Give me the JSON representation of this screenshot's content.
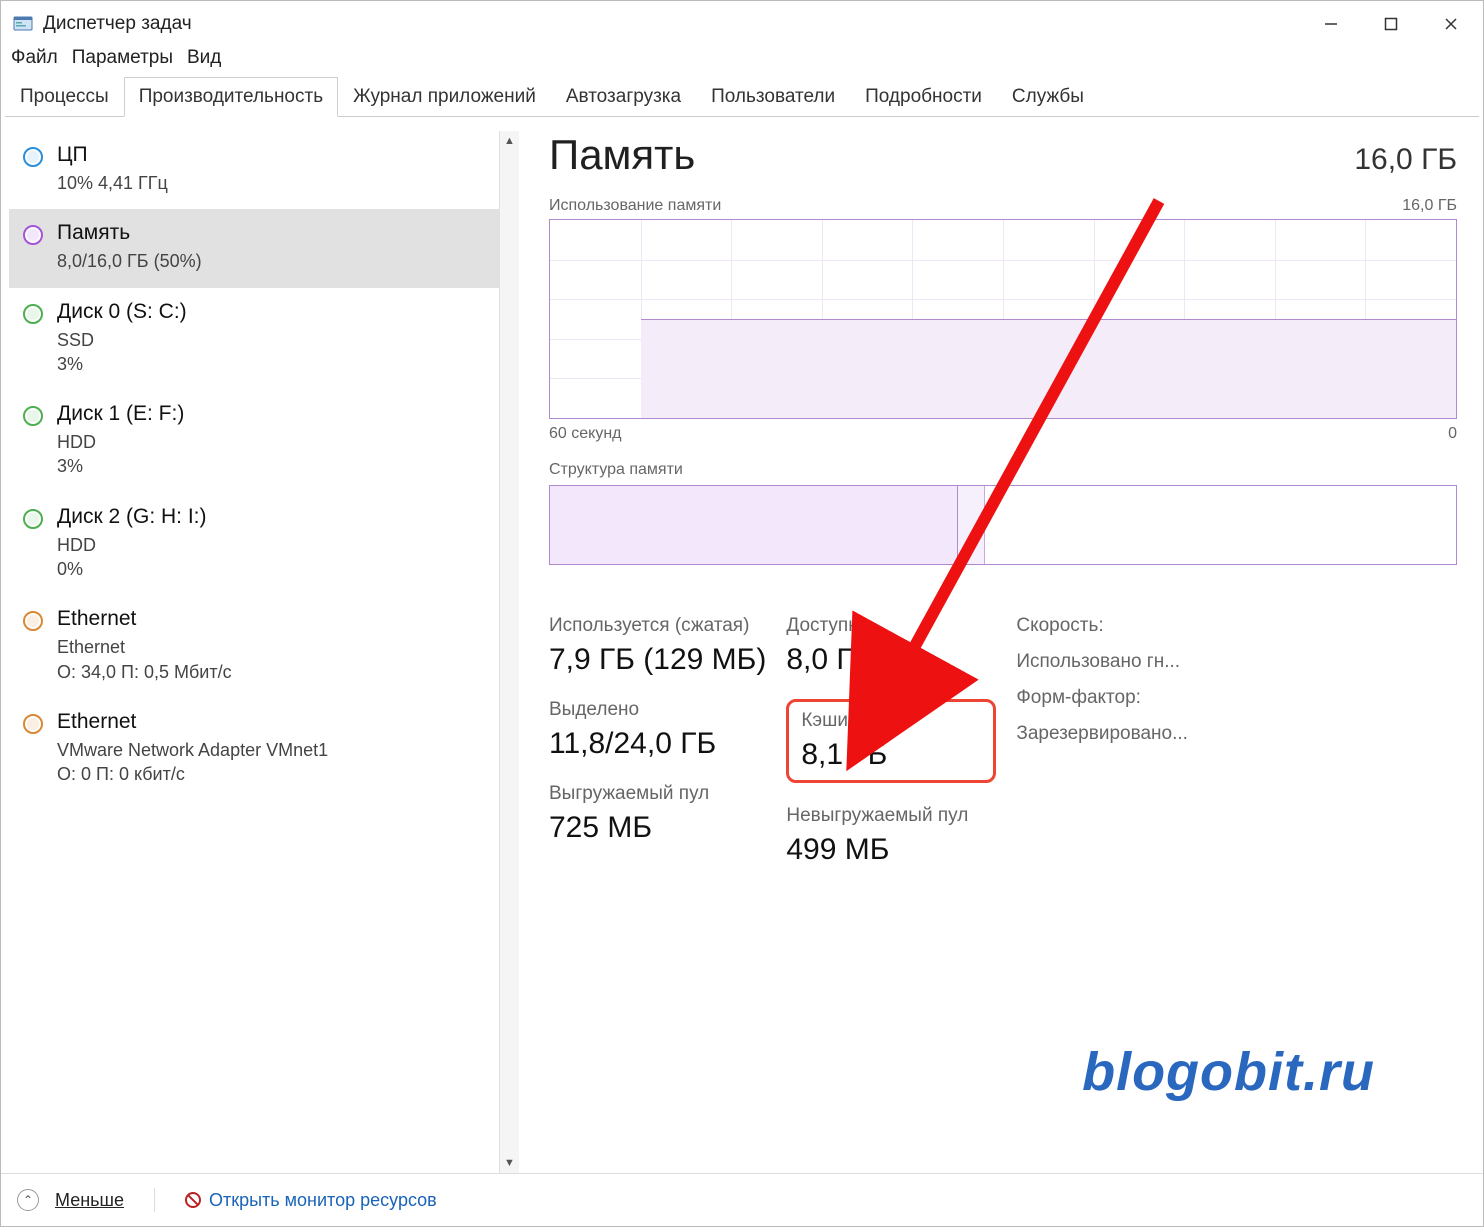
{
  "window": {
    "title": "Диспетчер задач"
  },
  "menu": {
    "file": "Файл",
    "options": "Параметры",
    "view": "Вид"
  },
  "tabs": {
    "processes": "Процессы",
    "performance": "Производительность",
    "app_history": "Журнал приложений",
    "startup": "Автозагрузка",
    "users": "Пользователи",
    "details": "Подробности",
    "services": "Службы"
  },
  "sidebar": {
    "items": [
      {
        "title": "ЦП",
        "sub": "10% 4,41 ГГц",
        "color": "blue"
      },
      {
        "title": "Память",
        "sub": "8,0/16,0 ГБ (50%)",
        "color": "purple"
      },
      {
        "title": "Диск 0 (S: C:)",
        "sub": "SSD\n3%",
        "color": "green"
      },
      {
        "title": "Диск 1 (E: F:)",
        "sub": "HDD\n3%",
        "color": "green"
      },
      {
        "title": "Диск 2 (G: H: I:)",
        "sub": "HDD\n0%",
        "color": "green"
      },
      {
        "title": "Ethernet",
        "sub": "Ethernet\nО: 34,0 П: 0,5 Мбит/с",
        "color": "orange"
      },
      {
        "title": "Ethernet",
        "sub": "VMware Network Adapter VMnet1\nО: 0 П: 0 кбит/с",
        "color": "orange"
      }
    ]
  },
  "main": {
    "title": "Память",
    "total": "16,0 ГБ",
    "usage_label": "Использование памяти",
    "usage_max": "16,0 ГБ",
    "xaxis_left": "60 секунд",
    "xaxis_right": "0",
    "composition_label": "Структура памяти",
    "stats": {
      "in_use_label": "Используется (сжатая)",
      "in_use_value": "7,9 ГБ (129 МБ)",
      "committed_label": "Выделено",
      "committed_value": "11,8/24,0 ГБ",
      "paged_label": "Выгружаемый пул",
      "paged_value": "725 МБ",
      "available_label": "Доступно",
      "available_value": "8,0 ГБ",
      "cached_label": "Кэшировано",
      "cached_value": "8,1 ГБ",
      "nonpaged_label": "Невыгружаемый пул",
      "nonpaged_value": "499 МБ",
      "speed_label": "Скорость:",
      "slots_label": "Использовано гн...",
      "form_label": "Форм-фактор:",
      "reserved_label": "Зарезервировано..."
    }
  },
  "footer": {
    "less": "Меньше",
    "resmon": "Открыть монитор ресурсов"
  },
  "watermark": "blogobit.ru",
  "chart_data": {
    "type": "area",
    "title": "Использование памяти",
    "xlabel": "60 секунд → 0",
    "ylabel": "ГБ",
    "ylim": [
      0,
      16
    ],
    "x_seconds": [
      60,
      55,
      50,
      45,
      40,
      35,
      30,
      25,
      20,
      15,
      10,
      5,
      0
    ],
    "values_gb": [
      0,
      0,
      0,
      8.0,
      8.0,
      8.0,
      8.0,
      8.0,
      8.0,
      8.0,
      8.0,
      8.0,
      8.0
    ]
  }
}
